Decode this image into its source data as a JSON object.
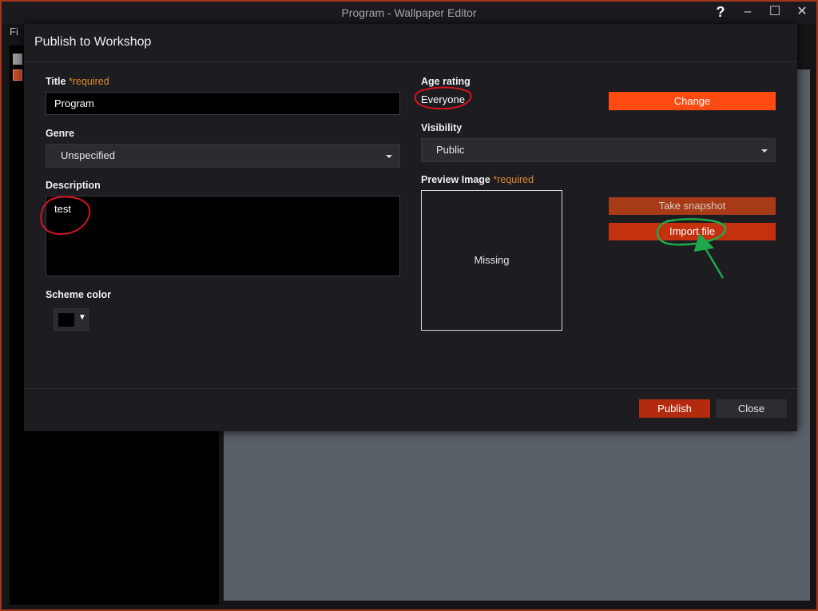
{
  "window": {
    "title": "Program - Wallpaper Editor",
    "controls": {
      "help": "?",
      "minimize": "–",
      "maximize": "☐",
      "close": "✕"
    },
    "menu_peek": "Fi"
  },
  "dialog": {
    "title": "Publish to Workshop",
    "title_field": {
      "label": "Title",
      "required": "*required",
      "value": "Program"
    },
    "genre": {
      "label": "Genre",
      "selected": "Unspecified"
    },
    "description": {
      "label": "Description",
      "value": "test"
    },
    "scheme_color": {
      "label": "Scheme color",
      "caret": "▼",
      "color": "#000000"
    },
    "age_rating": {
      "label": "Age rating",
      "value": "Everyone",
      "change_label": "Change"
    },
    "visibility": {
      "label": "Visibility",
      "selected": "Public"
    },
    "preview_image": {
      "label": "Preview Image",
      "required": "*required",
      "placeholder": "Missing",
      "take_snapshot_label": "Take snapshot",
      "import_file_label": "Import file"
    },
    "footer": {
      "publish_label": "Publish",
      "close_label": "Close"
    }
  },
  "colors": {
    "accent_orange": "#ff4b12",
    "required_text": "#e08a2b",
    "annotation_red": "#d4141e",
    "annotation_green": "#1fa84a"
  }
}
